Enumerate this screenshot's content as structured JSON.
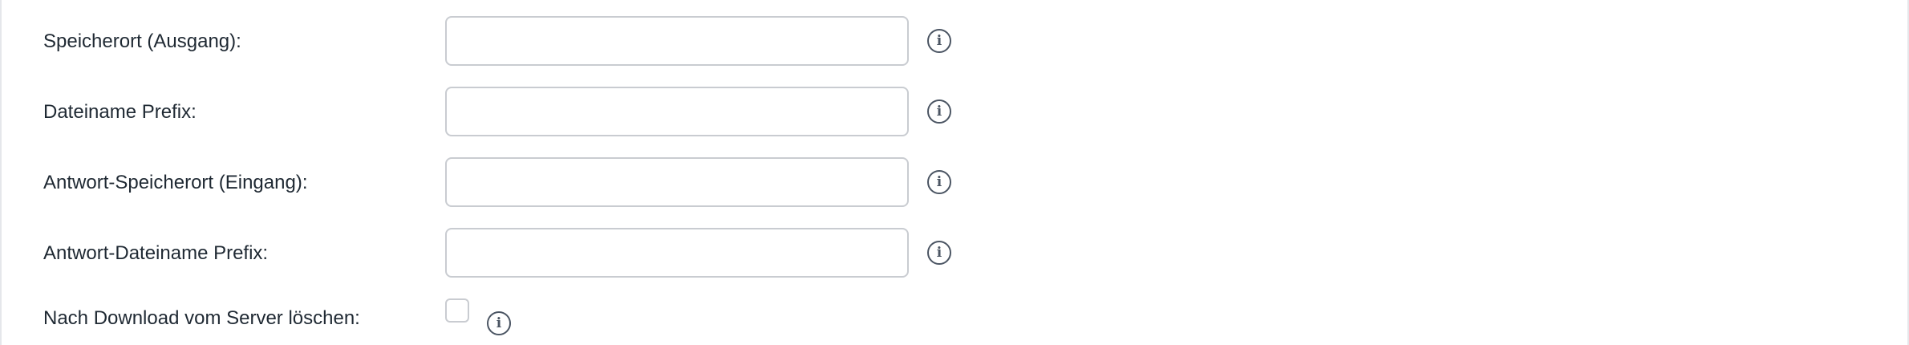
{
  "form": {
    "fields": [
      {
        "label": "Speicherort (Ausgang):",
        "value": "",
        "info_icon": "i"
      },
      {
        "label": "Dateiname Prefix:",
        "value": "",
        "info_icon": "i"
      },
      {
        "label": "Antwort-Speicherort (Eingang):",
        "value": "",
        "info_icon": "i"
      },
      {
        "label": "Antwort-Dateiname Prefix:",
        "value": "",
        "info_icon": "i"
      }
    ],
    "checkbox_field": {
      "label": "Nach Download vom Server löschen:",
      "checked": false,
      "info_icon": "i"
    }
  },
  "icons": {
    "info": "info-icon"
  },
  "colors": {
    "text": "#1f2933",
    "input_border": "#c9ccd1",
    "icon": "#4b5563",
    "background": "#ffffff"
  }
}
